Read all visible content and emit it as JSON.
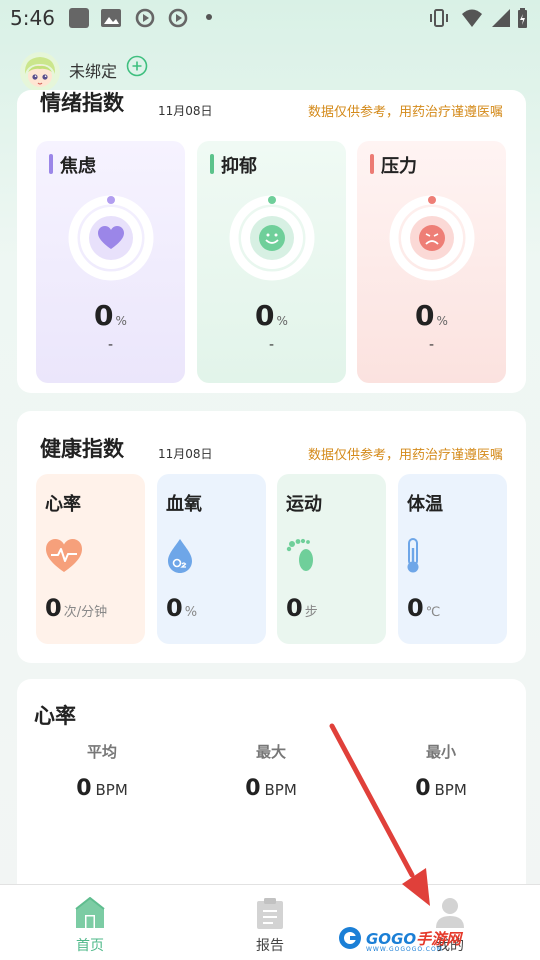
{
  "status_bar": {
    "time": "5:46",
    "left_icons": [
      "app-square-icon",
      "image-icon",
      "media-play-icon",
      "media-sync-icon"
    ],
    "right_icons": [
      "vibrate-icon",
      "wifi-icon",
      "signal-icon",
      "battery-icon"
    ]
  },
  "header": {
    "bind_status": "未绑定",
    "add_icon": "plus-circle-icon",
    "accent": "#3fbf7f"
  },
  "emotion": {
    "title": "情绪指数",
    "date": "11月08日",
    "note": "数据仅供参考，用药治疗谨遵医嘱",
    "items": [
      {
        "label": "焦虑",
        "value": "0",
        "unit": "%",
        "sub": "-",
        "color": "#9b86e8",
        "bg": "#efeaff",
        "icon": "heart-icon"
      },
      {
        "label": "抑郁",
        "value": "0",
        "unit": "%",
        "sub": "-",
        "color": "#5bc38b",
        "bg": "#e7f6ee",
        "icon": "smile-icon"
      },
      {
        "label": "压力",
        "value": "0",
        "unit": "%",
        "sub": "-",
        "color": "#ec7b74",
        "bg": "#fdeceb",
        "icon": "sad-face-icon"
      }
    ],
    "level": 0
  },
  "health": {
    "title": "健康指数",
    "date": "11月08日",
    "note": "数据仅供参考，用药治疗谨遵医嘱",
    "items": [
      {
        "label": "心率",
        "value": "0",
        "unit": "次/分钟",
        "icon": "heart-pulse-icon",
        "bg": "#fff1ea"
      },
      {
        "label": "血氧",
        "value": "0",
        "unit": "%",
        "icon": "oxygen-drop-icon",
        "bg": "#eaf2fd"
      },
      {
        "label": "运动",
        "value": "0",
        "unit": "步",
        "icon": "footprints-icon",
        "bg": "#e9f6ef"
      },
      {
        "label": "体温",
        "value": "0",
        "unit": "℃",
        "icon": "thermometer-icon",
        "bg": "#eaf2fd"
      }
    ]
  },
  "heart_rate": {
    "title": "心率",
    "stats": [
      {
        "label": "平均",
        "value": "0",
        "unit": "BPM"
      },
      {
        "label": "最大",
        "value": "0",
        "unit": "BPM"
      },
      {
        "label": "最小",
        "value": "0",
        "unit": "BPM"
      }
    ]
  },
  "bottom_nav": {
    "items": [
      {
        "label": "首页",
        "icon": "home-icon",
        "active": true
      },
      {
        "label": "报告",
        "icon": "report-clipboard-icon",
        "active": false
      },
      {
        "label": "我的",
        "icon": "user-icon",
        "active": false
      }
    ],
    "active_color": "#4fb98a"
  },
  "watermark": {
    "text_a": "GOGO",
    "text_b": "手游网",
    "sub": "WWW.GOGOGO.COM"
  }
}
